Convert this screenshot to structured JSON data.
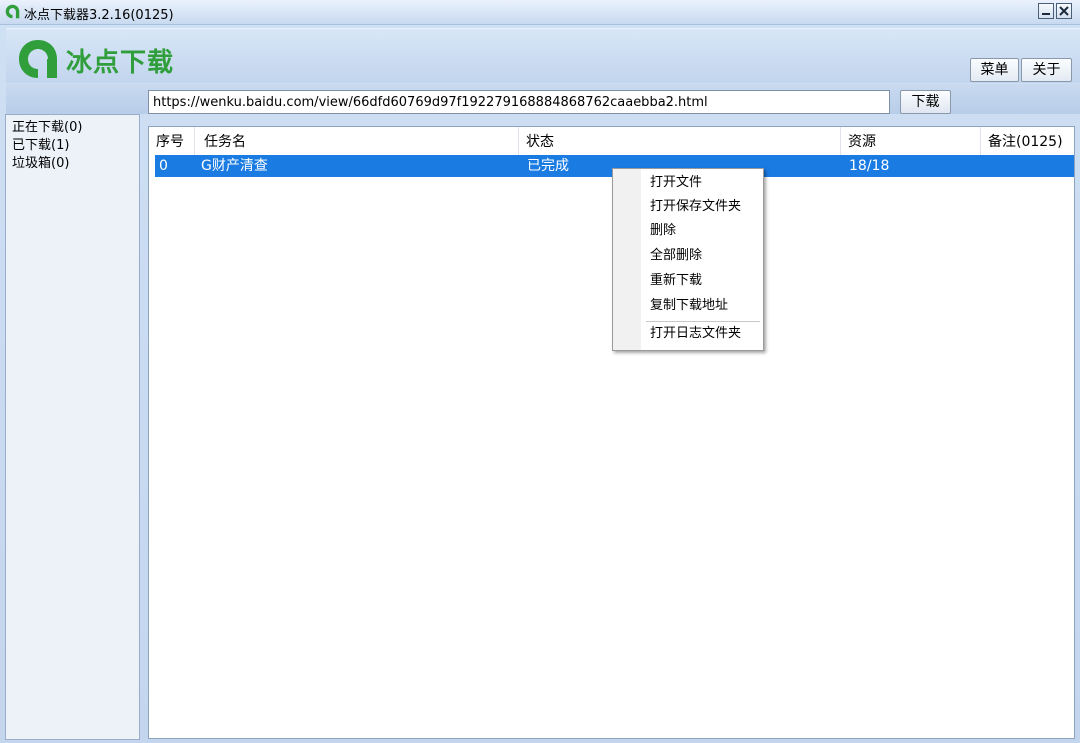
{
  "window": {
    "title": "冰点下载器3.2.16(0125)"
  },
  "header": {
    "logo_text": "冰点下载",
    "menu_label": "菜单",
    "about_label": "关于"
  },
  "toolbar": {
    "url_value": "https://wenku.baidu.com/view/66dfd60769d97f192279168884868762caaebba2.html",
    "download_label": "下载"
  },
  "sidebar": {
    "items": [
      {
        "label": "正在下载(0)"
      },
      {
        "label": "已下载(1)"
      },
      {
        "label": "垃圾箱(0)"
      }
    ]
  },
  "table": {
    "columns": [
      "序号",
      "任务名",
      "状态",
      "资源",
      "备注(0125)"
    ],
    "rows": [
      {
        "seq": "0",
        "name": "G财产清查",
        "status": "已完成",
        "resource": "18/18",
        "note": ""
      }
    ]
  },
  "context_menu": {
    "items": [
      "打开文件",
      "打开保存文件夹",
      "删除",
      "全部删除",
      "重新下载",
      "复制下载地址",
      "打开日志文件夹"
    ]
  },
  "colors": {
    "selection": "#1a7be3",
    "logo_green": "#2f9e3b",
    "window_bg": "#c3d6ee"
  }
}
